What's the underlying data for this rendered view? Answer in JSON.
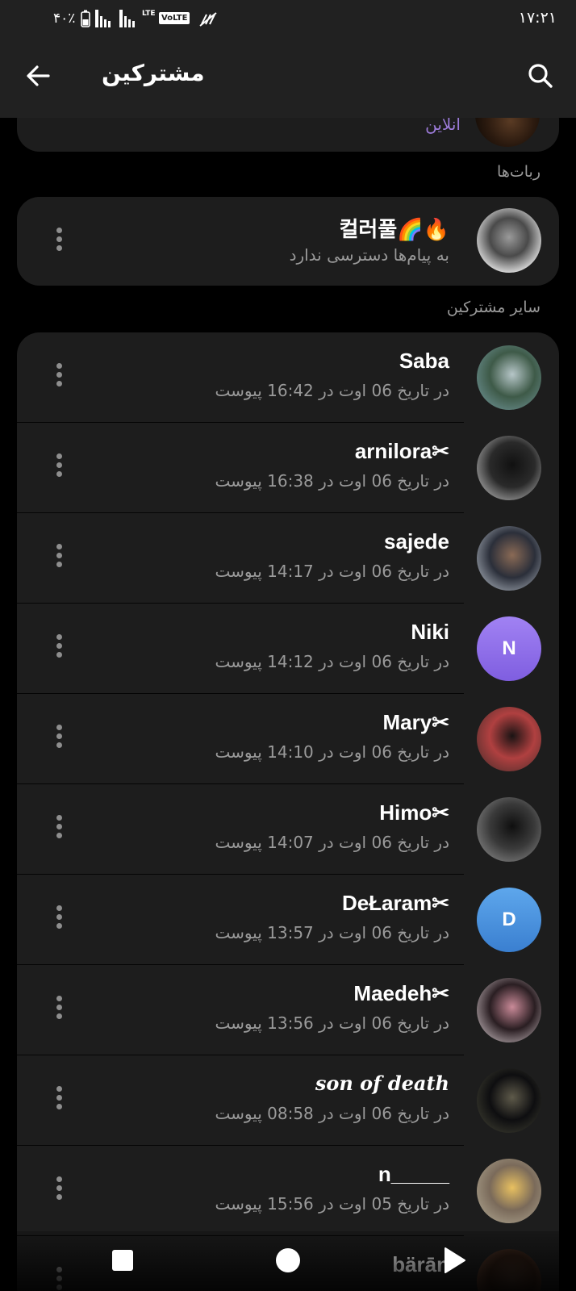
{
  "status_bar": {
    "battery_percent": "۴۰٪",
    "network": "LTE",
    "volte": "VoLTE",
    "time": "۱۷:۲۱"
  },
  "header": {
    "title": "مشترکین"
  },
  "top_partial": {
    "status": "آنلاین"
  },
  "sections": {
    "bots_label": "ربات‌ها",
    "others_label": "سایر مشترکین"
  },
  "bot": {
    "name": "컬러풀🌈🔥",
    "subtitle": "به پیام‌ها دسترسی ندارد"
  },
  "members": [
    {
      "name": "Saba",
      "subtitle": "در تاریخ 06 اوت در 16:42 پیوست",
      "avatar": "photo",
      "avatar_colors": [
        "#7aa0a8",
        "#3e5a48",
        "#b6c6c8"
      ]
    },
    {
      "name": "arnilora✂",
      "subtitle": "در تاریخ 06 اوت در 16:38 پیوست",
      "avatar": "photo",
      "avatar_colors": [
        "#d8d8d8",
        "#2a2a2a",
        "#111111"
      ]
    },
    {
      "name": "sajede",
      "subtitle": "در تاریخ 06 اوت در 14:17 پیوست",
      "avatar": "photo",
      "avatar_colors": [
        "#c7cfd8",
        "#2b2f3a",
        "#8a6a55"
      ]
    },
    {
      "name": "Niki",
      "subtitle": "در تاریخ 06 اوت در 14:12 پیوست",
      "avatar": "letter",
      "letter": "N",
      "avatar_colors": [
        "#a182f3",
        "#7f5ee0"
      ]
    },
    {
      "name": "Mary✂",
      "subtitle": "در تاریخ 06 اوت در 14:10 پیوست",
      "avatar": "photo",
      "avatar_colors": [
        "#3a2a28",
        "#b04040",
        "#1a1414"
      ]
    },
    {
      "name": "Himo✂",
      "subtitle": "در تاریخ 06 اوت در 14:07 پیوست",
      "avatar": "photo",
      "avatar_colors": [
        "#9a9a9a",
        "#3a3a3a",
        "#0f0f0f"
      ]
    },
    {
      "name": "DeŁaram✂",
      "subtitle": "در تاریخ 06 اوت در 13:57 پیوست",
      "avatar": "letter",
      "letter": "D",
      "avatar_colors": [
        "#5ea7ec",
        "#3a7fd0"
      ]
    },
    {
      "name": "Maedeh✂",
      "subtitle": "در تاریخ 06 اوت در 13:56 پیوست",
      "avatar": "photo",
      "avatar_colors": [
        "#e8dce0",
        "#2a1e22",
        "#c98a98"
      ]
    },
    {
      "name": "son of death",
      "subtitle": "در تاریخ 06 اوت در 08:58 پیوست",
      "avatar": "photo",
      "avatar_colors": [
        "#4a4a3a",
        "#0e0e10",
        "#5e5a4a"
      ],
      "fancy": true
    },
    {
      "name": "n_____",
      "subtitle": "در تاریخ 05 اوت در 15:56 پیوست",
      "avatar": "photo",
      "avatar_colors": [
        "#b8b09a",
        "#7a6a5a",
        "#e8c060"
      ]
    },
    {
      "name": "bärān",
      "subtitle": "",
      "avatar": "photo",
      "avatar_colors": [
        "#6a4a3a",
        "#2a1a12",
        "#3a2a22"
      ]
    }
  ],
  "colors": {
    "background": "#000000",
    "header": "#212121",
    "card": "#1d1d1d",
    "secondary_text": "#9a9a9a",
    "online": "#9c7bd9"
  }
}
